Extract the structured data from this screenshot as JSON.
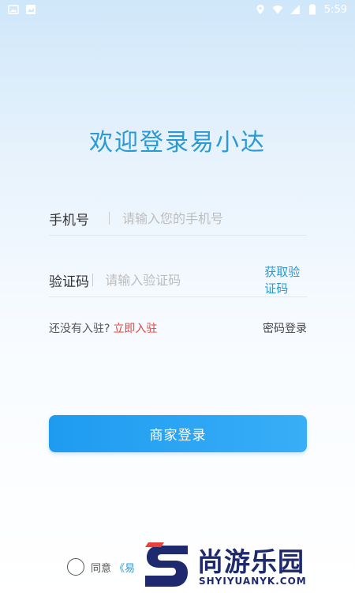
{
  "status_bar": {
    "time": "5:59"
  },
  "login": {
    "title": "欢迎登录易小达",
    "phone_label": "手机号",
    "phone_placeholder": "请输入您的手机号",
    "code_label": "验证码",
    "code_placeholder": "请输入验证码",
    "get_code": "获取验证码",
    "no_account": "还没有入驻?",
    "register_now": "立即入驻",
    "password_login": "密码登录",
    "login_button": "商家登录",
    "agree_text": "同意",
    "agree_link": "《易"
  },
  "watermark": {
    "brand": "尚游乐园",
    "domain": "SHYIYUANYK.COM"
  },
  "colors": {
    "accent": "#2a9ad6",
    "button": "#1e9bf0",
    "register": "#e8403a",
    "watermark": "#1f2a6e"
  }
}
